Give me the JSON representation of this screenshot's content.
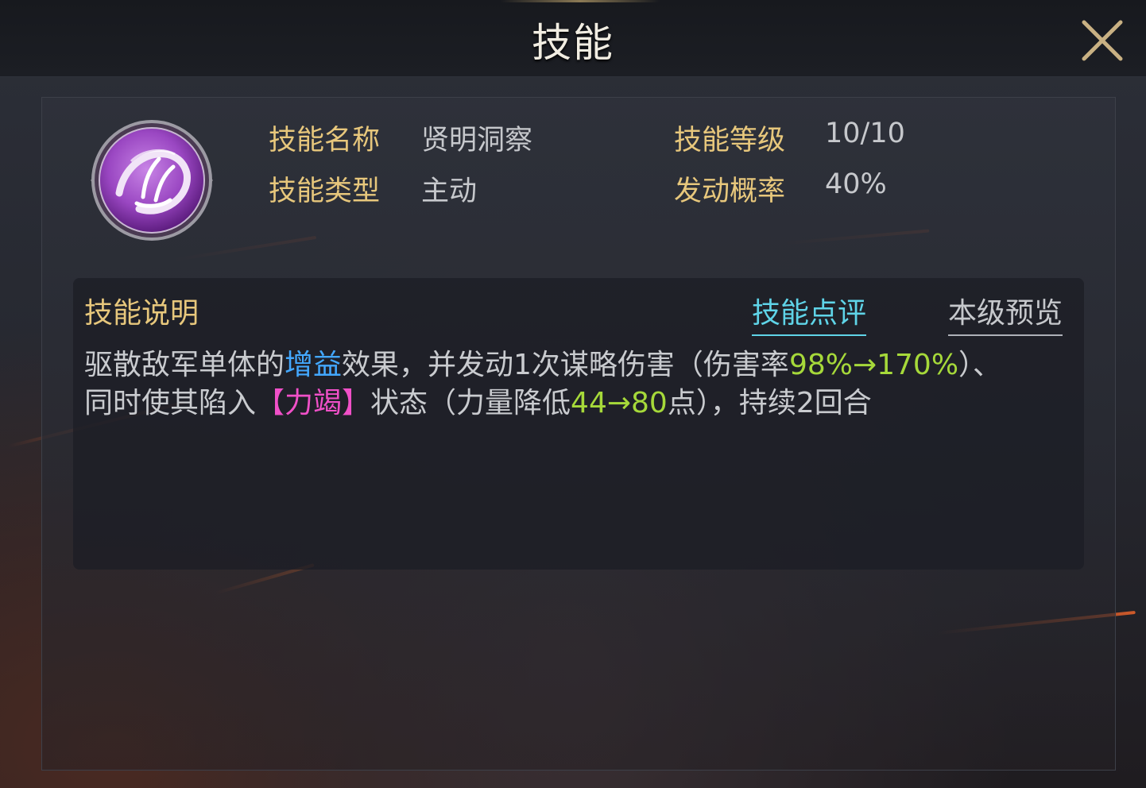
{
  "header": {
    "title": "技能"
  },
  "skill": {
    "name_label": "技能名称",
    "name_value": "贤明洞察",
    "type_label": "技能类型",
    "type_value": "主动",
    "level_label": "技能等级",
    "level_value": "10/10",
    "chance_label": "发动概率",
    "chance_value": "40%"
  },
  "description": {
    "title": "技能说明",
    "tabs": {
      "review": "技能点评",
      "preview": "本级预览"
    },
    "line1": {
      "p1": "驱散敌军单体的",
      "buff": "增益",
      "p2": "效果，并发动1次谋略伤害（伤害率",
      "rate": "98%→170%",
      "p3": "）、"
    },
    "line2": {
      "p1": "同时使其陷入",
      "status": "【力竭】",
      "p2": "状态（力量降低",
      "amount": "44→80",
      "p3": "点），持续2回合"
    }
  },
  "colors": {
    "gold_label": "#e7c77c",
    "blue_highlight": "#43a8ff",
    "green_highlight": "#a6d93a",
    "pink_highlight": "#f050c8",
    "tab_active": "#5fd4e8"
  },
  "icons": {
    "close": "close-x-icon",
    "skill": "purple-hand-skill-icon"
  }
}
